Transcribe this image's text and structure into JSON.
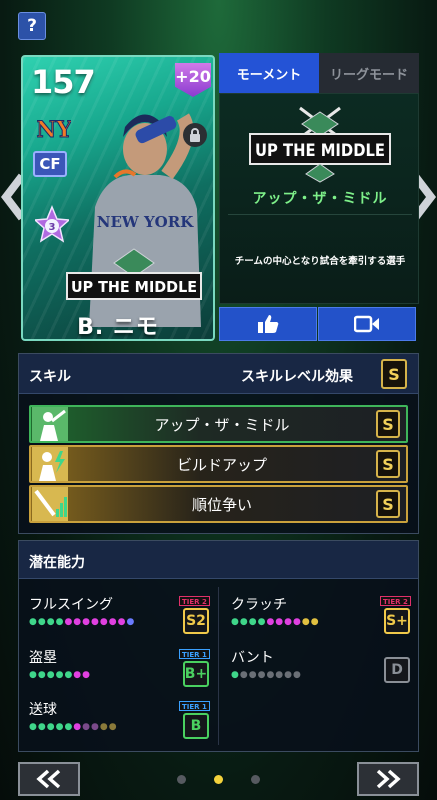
{
  "help_label": "?",
  "card": {
    "rating": "157",
    "plus": "+20",
    "position": "CF",
    "name": "B. ニモ",
    "team_logo_text": "NY",
    "emblem_text": "UP THE MIDDLE",
    "jersey_text": "NEW YORK"
  },
  "tabs": [
    {
      "label": "モーメント",
      "active": true
    },
    {
      "label": "リーグモード",
      "active": false
    }
  ],
  "moment": {
    "emblem_text": "UP THE MIDDLE",
    "name": "アップ・ザ・ミドル",
    "description": "チームの中心となり試合を牽引する選手"
  },
  "skills": {
    "title": "スキル",
    "effect_label": "スキルレベル効果",
    "effect_grade": "S",
    "items": [
      {
        "name": "アップ・ザ・ミドル",
        "grade": "S",
        "style": "green"
      },
      {
        "name": "ビルドアップ",
        "grade": "S",
        "style": "gold"
      },
      {
        "name": "順位争い",
        "grade": "S",
        "style": "gold"
      }
    ]
  },
  "potential": {
    "title": "潜在能力",
    "items": [
      {
        "name": "フルスイング",
        "tier": "TIER 2",
        "grade": "S2",
        "tier_color": "#e0306a",
        "grade_color": "#f0c94a",
        "dots": [
          "#3fd68a",
          "#3fd68a",
          "#3fd68a",
          "#3fd68a",
          "#e040e0",
          "#e040e0",
          "#e040e0",
          "#e040e0",
          "#e040e0",
          "#e040e0",
          "#e040e0",
          "#6a7bff"
        ]
      },
      {
        "name": "クラッチ",
        "tier": "TIER 2",
        "grade": "S+",
        "tier_color": "#e0306a",
        "grade_color": "#f0c94a",
        "dots": [
          "#3fd68a",
          "#3fd68a",
          "#3fd68a",
          "#3fd68a",
          "#e040e0",
          "#e040e0",
          "#e040e0",
          "#e040e0",
          "#e0c040",
          "#e0c040"
        ]
      },
      {
        "name": "盗塁",
        "tier": "TIER 1",
        "grade": "B+",
        "tier_color": "#3aa0ff",
        "grade_color": "#4ad060",
        "dots": [
          "#3fd68a",
          "#3fd68a",
          "#3fd68a",
          "#3fd68a",
          "#3fd68a",
          "#e040e0",
          "#e040e0"
        ]
      },
      {
        "name": "バント",
        "tier": "",
        "grade": "D",
        "tier_color": "",
        "grade_color": "#8a8f96",
        "dots": [
          "#3fd68a",
          "#6a6f76",
          "#6a6f76",
          "#6a6f76",
          "#6a6f76",
          "#6a6f76",
          "#6a6f76",
          "#6a6f76"
        ]
      },
      {
        "name": "送球",
        "tier": "TIER 1",
        "grade": "B",
        "tier_color": "#3aa0ff",
        "grade_color": "#4ad060",
        "dots": [
          "#3fd68a",
          "#3fd68a",
          "#3fd68a",
          "#3fd68a",
          "#3fd68a",
          "#e040e0",
          "#7a4a8a",
          "#7a4a8a",
          "#8a7a3a",
          "#8a7a3a"
        ]
      }
    ]
  },
  "pagination": {
    "count": 3,
    "active": 1
  }
}
